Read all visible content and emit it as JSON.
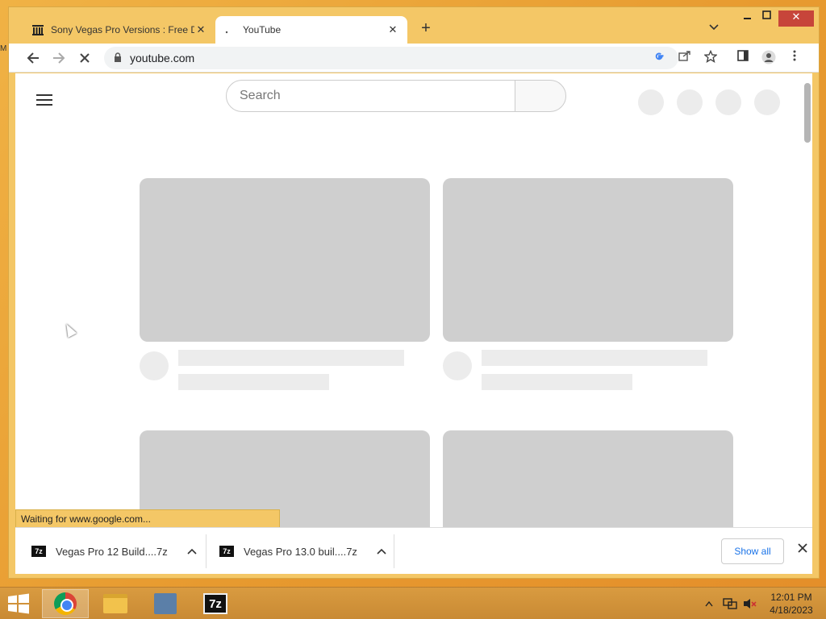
{
  "browser": {
    "tabs": [
      {
        "title": "Sony Vegas Pro Versions : Free D",
        "favicon": "archive-icon",
        "active": false
      },
      {
        "title": "YouTube",
        "favicon": "loading-dot-icon",
        "active": true
      }
    ],
    "new_tab_label": "+",
    "address": "youtube.com",
    "status_text": "Waiting for www.google.com..."
  },
  "youtube": {
    "search_placeholder": "Search"
  },
  "downloads": {
    "items": [
      {
        "name": "Vegas Pro 12 Build....7z",
        "icon": "7z"
      },
      {
        "name": "Vegas Pro 13.0 buil....7z",
        "icon": "7z"
      }
    ],
    "show_all_label": "Show all"
  },
  "taskbar": {
    "apps": [
      "chrome-icon",
      "file-explorer-icon",
      "network-icon",
      "7zip-icon"
    ],
    "sevenzip_label": "7z",
    "time": "12:01 PM",
    "date": "4/18/2023"
  }
}
